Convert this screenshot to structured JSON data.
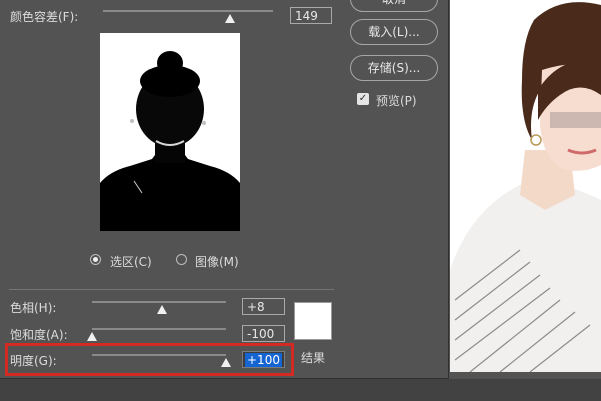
{
  "dialog": {
    "fuzziness_label": "颜色容差(F):",
    "fuzziness_value": "149",
    "fuzziness_level": 0.74,
    "buttons": {
      "top_partial": "取消",
      "load": "载入(L)...",
      "save": "存储(S)..."
    },
    "preview_checkbox": {
      "label": "预览(P)",
      "checked": true
    },
    "view_options": {
      "selection": {
        "label": "选区(C)",
        "selected": true
      },
      "image": {
        "label": "图像(M)",
        "selected": false
      }
    },
    "replacement": {
      "hue": {
        "label": "色相(H):",
        "value": "+8",
        "level": 0.52
      },
      "saturation": {
        "label": "饱和度(A):",
        "value": "-100",
        "level": 0.0
      },
      "lightness": {
        "label": "明度(G):",
        "value": "+100",
        "level": 1.0
      },
      "result_label": "结果",
      "result_color": "#ffffff"
    }
  },
  "colors": {
    "panel": "#535353",
    "highlight_border": "#d32a24",
    "selection_blue": "#1464d2"
  }
}
